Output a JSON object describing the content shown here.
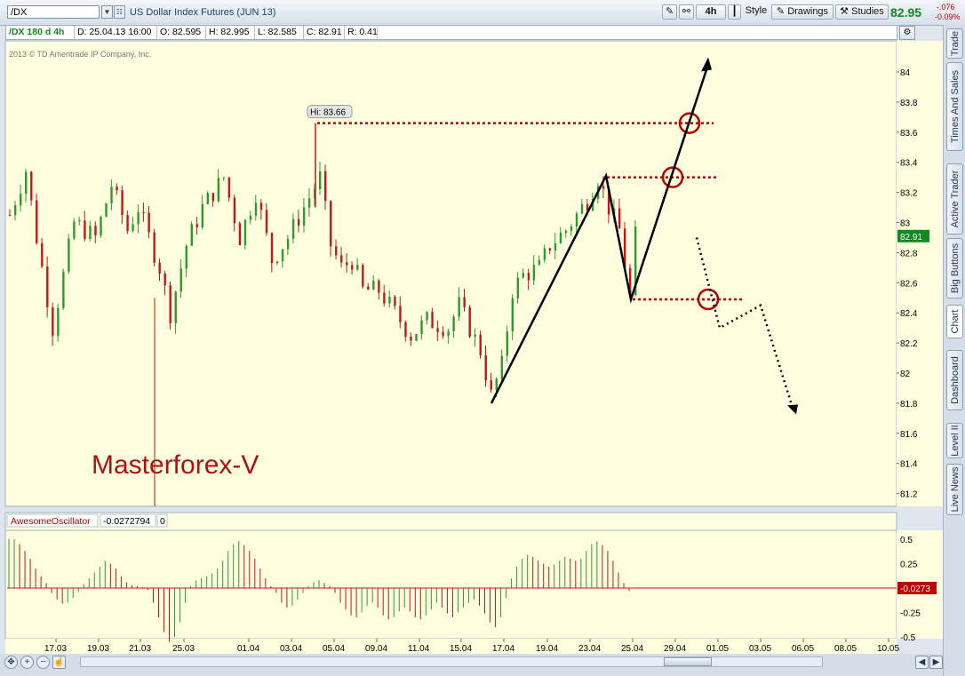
{
  "toolbar": {
    "symbol": "/DX",
    "description": "US Dollar Index Futures (JUN 13)",
    "timeframe": "4h",
    "style_label": "Style",
    "drawings_label": "Drawings",
    "studies_label": "Studies",
    "last_price": "82.95",
    "net_change": "-.076",
    "pct_change": "-0.09%"
  },
  "sidebar": {
    "tabs": [
      "Trade",
      "Times And Sales",
      "Active Trader",
      "Big Buttons",
      "Chart",
      "Dashboard",
      "Level II",
      "Live News"
    ],
    "active": "Chart"
  },
  "info_bar": {
    "symbol_period": "/DX 180 d 4h",
    "date": "D: 25.04.13 16:00",
    "open": "O: 82.595",
    "high": "H: 82.995",
    "low": "L: 82.585",
    "close": "C: 82.91",
    "range": "R: 0.41"
  },
  "colors": {
    "background": "#ffffe0",
    "up": "#2e9a2e",
    "down": "#c01818",
    "level_line": "#c00000",
    "projection": "#000000"
  },
  "chart_data": [
    {
      "type": "candlestick",
      "copyright": "2013 © TD Ameritrade IP Company, Inc.",
      "watermark": "Masterforex-V",
      "hi_label": "Hi: 83.66",
      "y_ticks": [
        "84",
        "83.8",
        "83.6",
        "83.4",
        "83.2",
        "83",
        "82.8",
        "82.6",
        "82.4",
        "82.2",
        "82",
        "81.8",
        "81.6",
        "81.4",
        "81.2"
      ],
      "ylim": [
        81.1,
        84.5
      ],
      "current_price_tag": "82.91",
      "x_ticks": [
        "17.03",
        "19.03",
        "21.03",
        "25.03",
        "01.04",
        "03.04",
        "05.04",
        "09.04",
        "11.04",
        "15.04",
        "17.04",
        "19.04",
        "23.04",
        "25.04",
        "29.04",
        "01.05",
        "03.05",
        "06.05",
        "08.05",
        "10.05"
      ],
      "n_bars": 117,
      "close_path": [
        {
          "bar": 0,
          "price": 83.05
        },
        {
          "bar": 3,
          "price": 83.35
        },
        {
          "bar": 5,
          "price": 82.9
        },
        {
          "bar": 8,
          "price": 82.3
        },
        {
          "bar": 12,
          "price": 83.0
        },
        {
          "bar": 16,
          "price": 82.9
        },
        {
          "bar": 19,
          "price": 83.25
        },
        {
          "bar": 22,
          "price": 82.95
        },
        {
          "bar": 24,
          "price": 83.1
        },
        {
          "bar": 28,
          "price": 82.7
        },
        {
          "bar": 30,
          "price": 82.4
        },
        {
          "bar": 33,
          "price": 82.85
        },
        {
          "bar": 36,
          "price": 83.1
        },
        {
          "bar": 40,
          "price": 83.3
        },
        {
          "bar": 43,
          "price": 82.9
        },
        {
          "bar": 46,
          "price": 83.2
        },
        {
          "bar": 49,
          "price": 82.75
        },
        {
          "bar": 52,
          "price": 82.9
        },
        {
          "bar": 55,
          "price": 83.1
        },
        {
          "bar": 58,
          "price": 83.3
        },
        {
          "bar": 60,
          "price": 82.85
        },
        {
          "bar": 62,
          "price": 82.7
        },
        {
          "bar": 64,
          "price": 82.75
        },
        {
          "bar": 66,
          "price": 82.55
        },
        {
          "bar": 69,
          "price": 82.55
        },
        {
          "bar": 72,
          "price": 82.4
        },
        {
          "bar": 75,
          "price": 82.25
        },
        {
          "bar": 78,
          "price": 82.35
        },
        {
          "bar": 82,
          "price": 82.3
        },
        {
          "bar": 84,
          "price": 82.45
        },
        {
          "bar": 86,
          "price": 82.3
        },
        {
          "bar": 88,
          "price": 82.15
        },
        {
          "bar": 90,
          "price": 81.85
        },
        {
          "bar": 92,
          "price": 82.05
        },
        {
          "bar": 94,
          "price": 82.55
        },
        {
          "bar": 96,
          "price": 82.65
        },
        {
          "bar": 99,
          "price": 82.7
        },
        {
          "bar": 101,
          "price": 82.85
        },
        {
          "bar": 104,
          "price": 82.95
        },
        {
          "bar": 106,
          "price": 83.05
        },
        {
          "bar": 108,
          "price": 83.15
        },
        {
          "bar": 110,
          "price": 83.3
        },
        {
          "bar": 112,
          "price": 83.1
        },
        {
          "bar": 114,
          "price": 82.95
        },
        {
          "bar": 116,
          "price": 82.5
        },
        {
          "bar": 117,
          "price": 82.91
        }
      ],
      "levels": [
        83.66,
        83.3,
        82.49
      ],
      "projection": {
        "swing_low": {
          "date": "17.04",
          "price": 81.8
        },
        "swing_high": {
          "date": "24.04",
          "price": 83.31
        },
        "pullback_low": {
          "date": "25.04",
          "price": 82.49
        },
        "target": {
          "date": "01.05",
          "price": 84.05
        },
        "alt_path": [
          {
            "date": "29.04",
            "price": 82.9
          },
          {
            "date": "30.04",
            "price": 82.3
          },
          {
            "date": "02.05",
            "price": 82.45
          },
          {
            "date": "04.05",
            "price": 81.75
          }
        ]
      }
    },
    {
      "type": "bar",
      "name": "AwesomeOscillator",
      "value_label": "-0.0272794",
      "extra_label": "0",
      "y_ticks": [
        "0.5",
        "0.25",
        "-0.25",
        "-0.5"
      ],
      "ylim": [
        -0.55,
        0.62
      ],
      "current_value_tag": "-0.0273",
      "values": [
        0.5,
        0.5,
        0.45,
        0.38,
        0.3,
        0.2,
        0.12,
        0.05,
        -0.05,
        -0.12,
        -0.16,
        -0.15,
        -0.1,
        -0.04,
        0.04,
        0.1,
        0.16,
        0.22,
        0.28,
        0.25,
        0.2,
        0.12,
        0.06,
        0.03,
        0.02,
        0.01,
        -0.02,
        -0.15,
        -0.3,
        -0.45,
        -0.55,
        -0.5,
        -0.35,
        -0.15,
        0.02,
        0.08,
        0.1,
        0.12,
        0.15,
        0.2,
        0.28,
        0.38,
        0.45,
        0.48,
        0.44,
        0.38,
        0.3,
        0.2,
        0.1,
        0.02,
        -0.05,
        -0.15,
        -0.2,
        -0.18,
        -0.12,
        -0.05,
        0.02,
        0.06,
        0.08,
        0.05,
        0.02,
        -0.05,
        -0.15,
        -0.22,
        -0.28,
        -0.3,
        -0.25,
        -0.18,
        -0.15,
        -0.2,
        -0.28,
        -0.32,
        -0.3,
        -0.24,
        -0.2,
        -0.24,
        -0.3,
        -0.32,
        -0.28,
        -0.22,
        -0.15,
        -0.2,
        -0.26,
        -0.3,
        -0.25,
        -0.2,
        -0.15,
        -0.12,
        -0.18,
        -0.26,
        -0.35,
        -0.4,
        -0.3,
        -0.1,
        0.1,
        0.22,
        0.3,
        0.34,
        0.32,
        0.28,
        0.25,
        0.22,
        0.24,
        0.28,
        0.32,
        0.3,
        0.28,
        0.3,
        0.38,
        0.45,
        0.48,
        0.44,
        0.38,
        0.28,
        0.16,
        0.05,
        -0.03
      ]
    }
  ]
}
